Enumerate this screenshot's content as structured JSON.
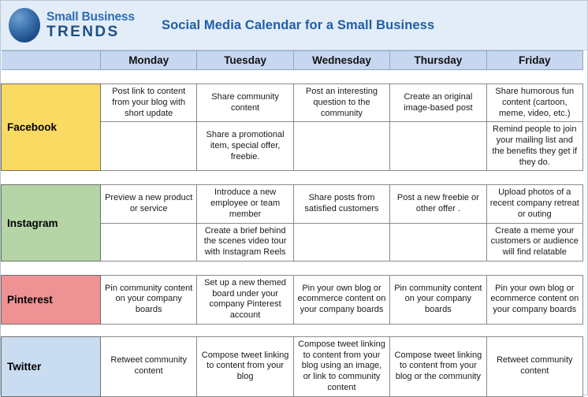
{
  "banner": {
    "logo": {
      "line1": "Small Business",
      "line2": "TRENDS",
      "icon": "blue-circle-logo"
    },
    "title": "Social Media Calendar for a Small Business",
    "title_color": "#1f5ea8",
    "background_color": "#e3edf8"
  },
  "table": {
    "corner_label": "",
    "day_headers": [
      "Monday",
      "Tuesday",
      "Wednesday",
      "Thursday",
      "Friday"
    ],
    "header_background": "#c7d7f0",
    "platforms": [
      {
        "name": "Facebook",
        "color": "#FADA63",
        "rows": [
          [
            "Post link to content from your blog with short update",
            "Share community content",
            "Post an interesting question to the community",
            "Create an original image-based post",
            "Share humorous fun content (cartoon, meme, video, etc.)"
          ],
          [
            "",
            "Share a promotional item, special offer, freebie.",
            "",
            "",
            "Remind people to join your mailing list and the benefits they get if they do."
          ]
        ]
      },
      {
        "name": "Instagram",
        "color": "#B5D5A7",
        "rows": [
          [
            "Preview a new product or service",
            "Introduce a new employee or team member",
            "Share posts from satisfied customers",
            "Post a new freebie or other offer .",
            "Upload photos of a recent company retreat or outing"
          ],
          [
            "",
            "Create a brief behind the scenes video tour with Instagram Reels",
            "",
            "",
            "Create a meme your customers or audience will find relatable"
          ]
        ]
      },
      {
        "name": "Pinterest",
        "color": "#EE9294",
        "rows": [
          [
            "Pin community content on your company boards",
            "Set up a new themed board under your company Pinterest account",
            "Pin your own blog or ecommerce content on your company boards",
            "Pin community content on your company boards",
            "Pin your own blog or ecommerce content on your company boards"
          ]
        ]
      },
      {
        "name": "Twitter",
        "color": "#C9DCF0",
        "rows": [
          [
            "Retweet community content",
            "Compose tweet linking to content from your blog",
            "Compose tweet linking to content from your blog using an image, or link to community content",
            "Compose tweet linking to content from your blog or the community",
            "Retweet community content"
          ]
        ]
      }
    ]
  }
}
